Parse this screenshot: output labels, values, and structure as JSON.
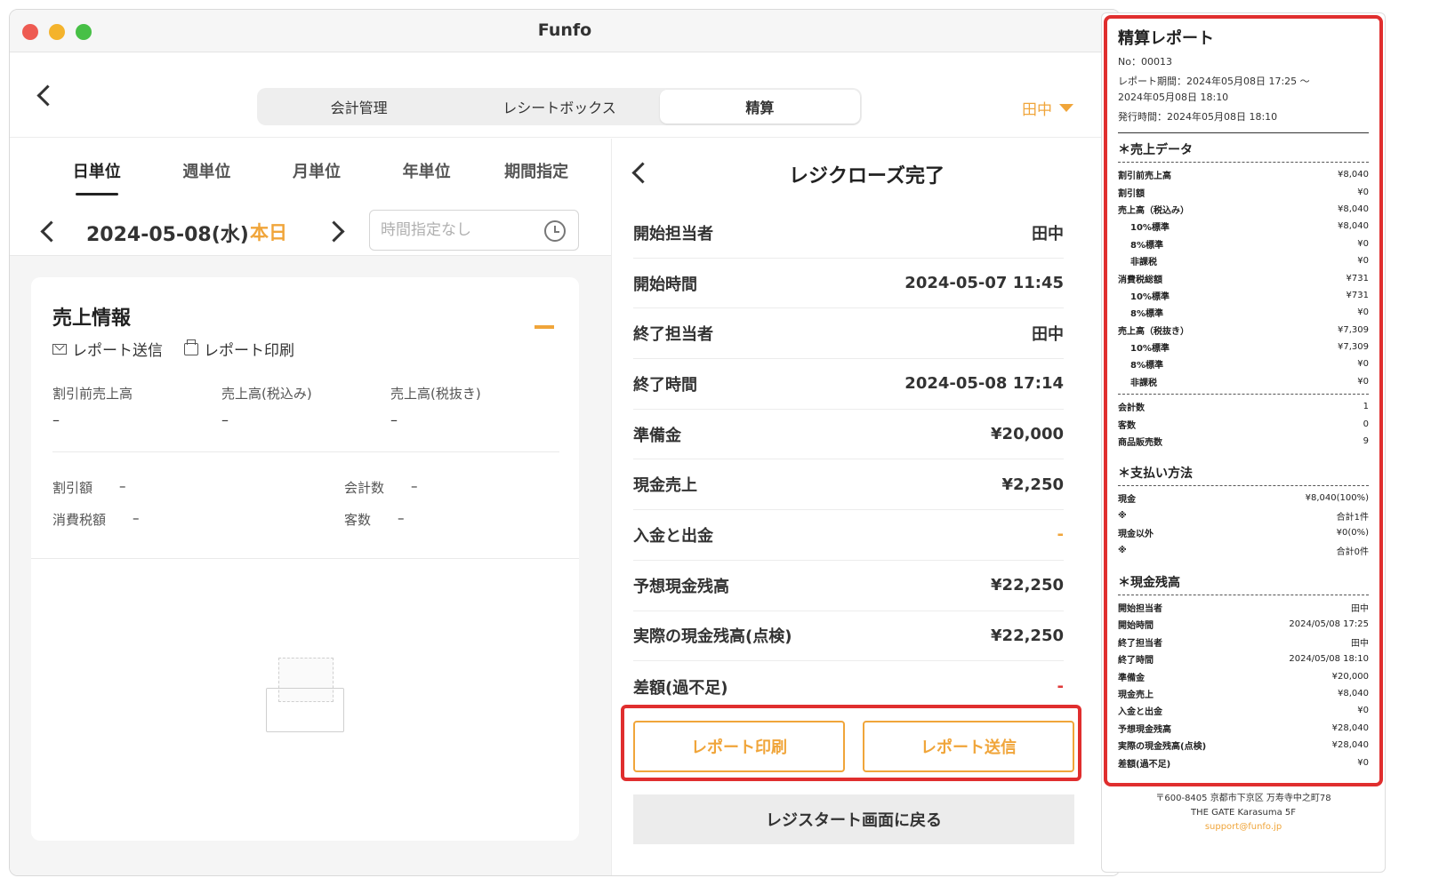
{
  "window": {
    "title": "Funfo"
  },
  "header": {
    "tabs": [
      {
        "label": "会計管理"
      },
      {
        "label": "レシートボックス"
      },
      {
        "label": "精算"
      }
    ],
    "user": "田中"
  },
  "left": {
    "period_tabs": [
      "日単位",
      "週単位",
      "月単位",
      "年単位",
      "期間指定"
    ],
    "date": "2024-05-08(水)",
    "today_label": "本日",
    "time_placeholder": "時間指定なし",
    "card": {
      "title": "売上情報",
      "actions": {
        "send": "レポート送信",
        "print": "レポート印刷"
      },
      "stats": [
        {
          "label": "割引前売上高",
          "value": "–"
        },
        {
          "label": "売上高(税込み)",
          "value": "–"
        },
        {
          "label": "売上高(税抜き)",
          "value": "–"
        }
      ],
      "kv": [
        {
          "label": "割引額",
          "value": "–"
        },
        {
          "label": "会計数",
          "value": "–"
        },
        {
          "label": "消費税額",
          "value": "–"
        },
        {
          "label": "客数",
          "value": "–"
        }
      ]
    }
  },
  "middle": {
    "title": "レジクローズ完了",
    "rows": [
      {
        "label": "開始担当者",
        "value": "田中"
      },
      {
        "label": "開始時間",
        "value": "2024-05-07 11:45"
      },
      {
        "label": "終了担当者",
        "value": "田中"
      },
      {
        "label": "終了時間",
        "value": "2024-05-08 17:14"
      },
      {
        "label": "準備金",
        "value": "¥20,000"
      },
      {
        "label": "現金売上",
        "value": "¥2,250"
      },
      {
        "label": "入金と出金",
        "value": "-"
      },
      {
        "label": "予想現金残高",
        "value": "¥22,250"
      },
      {
        "label": "実際の現金残高(点検)",
        "value": "¥22,250"
      },
      {
        "label": "差額(過不足)",
        "value": "-"
      }
    ],
    "buttons": {
      "print": "レポート印刷",
      "send": "レポート送信",
      "back": "レジスタート画面に戻る"
    }
  },
  "receipt": {
    "title": "精算レポート",
    "no": "No：00013",
    "period_line1": "レポート期間：2024年05月08日 17:25 〜",
    "period_line2": "2024年05月08日 18:10",
    "issued": "発行時間：2024年05月08日 18:10",
    "sales_title": "＊売上データ",
    "sales_rows": [
      {
        "k": "割引前売上高",
        "v": "¥8,040"
      },
      {
        "k": "割引額",
        "v": "¥0"
      },
      {
        "k": "売上高（税込み）",
        "v": "¥8,040"
      },
      {
        "k": "10%標準",
        "v": "¥8,040"
      },
      {
        "k": "8%標準",
        "v": "¥0"
      },
      {
        "k": "非課税",
        "v": "¥0"
      },
      {
        "k": "消費税総額",
        "v": "¥731"
      },
      {
        "k": "10%標準",
        "v": "¥731"
      },
      {
        "k": "8%標準",
        "v": "¥0"
      },
      {
        "k": "売上高（税抜き）",
        "v": "¥7,309"
      },
      {
        "k": "10%標準",
        "v": "¥7,309"
      },
      {
        "k": "8%標準",
        "v": "¥0"
      },
      {
        "k": "非課税",
        "v": "¥0"
      }
    ],
    "count_rows": [
      {
        "k": "会計数",
        "v": "1"
      },
      {
        "k": "客数",
        "v": "0"
      },
      {
        "k": "商品販売数",
        "v": "9"
      }
    ],
    "pay_title": "＊支払い方法",
    "pay_rows": [
      {
        "k": "現金",
        "v": "¥8,040(100%)"
      },
      {
        "k": "※",
        "v": "合計1件"
      },
      {
        "k": "現金以外",
        "v": "¥0(0%)"
      },
      {
        "k": "※",
        "v": "合計0件"
      }
    ],
    "cash_title": "＊現金残高",
    "cash_rows": [
      {
        "k": "開始担当者",
        "v": "田中"
      },
      {
        "k": "開始時間",
        "v": "2024/05/08 17:25"
      },
      {
        "k": "終了担当者",
        "v": "田中"
      },
      {
        "k": "終了時間",
        "v": "2024/05/08 18:10"
      },
      {
        "k": "準備金",
        "v": "¥20,000"
      },
      {
        "k": "現金売上",
        "v": "¥8,040"
      },
      {
        "k": "入金と出金",
        "v": "¥0"
      },
      {
        "k": "予想現金残高",
        "v": "¥28,040"
      },
      {
        "k": "実際の現金残高(点検)",
        "v": "¥28,040"
      },
      {
        "k": "差額(過不足)",
        "v": "¥0"
      }
    ],
    "footer": {
      "address": "〒600-8405 京都市下京区 万寿寺中之町78",
      "building": "THE GATE Karasuma 5F",
      "email": "support@funfo.jp"
    }
  }
}
